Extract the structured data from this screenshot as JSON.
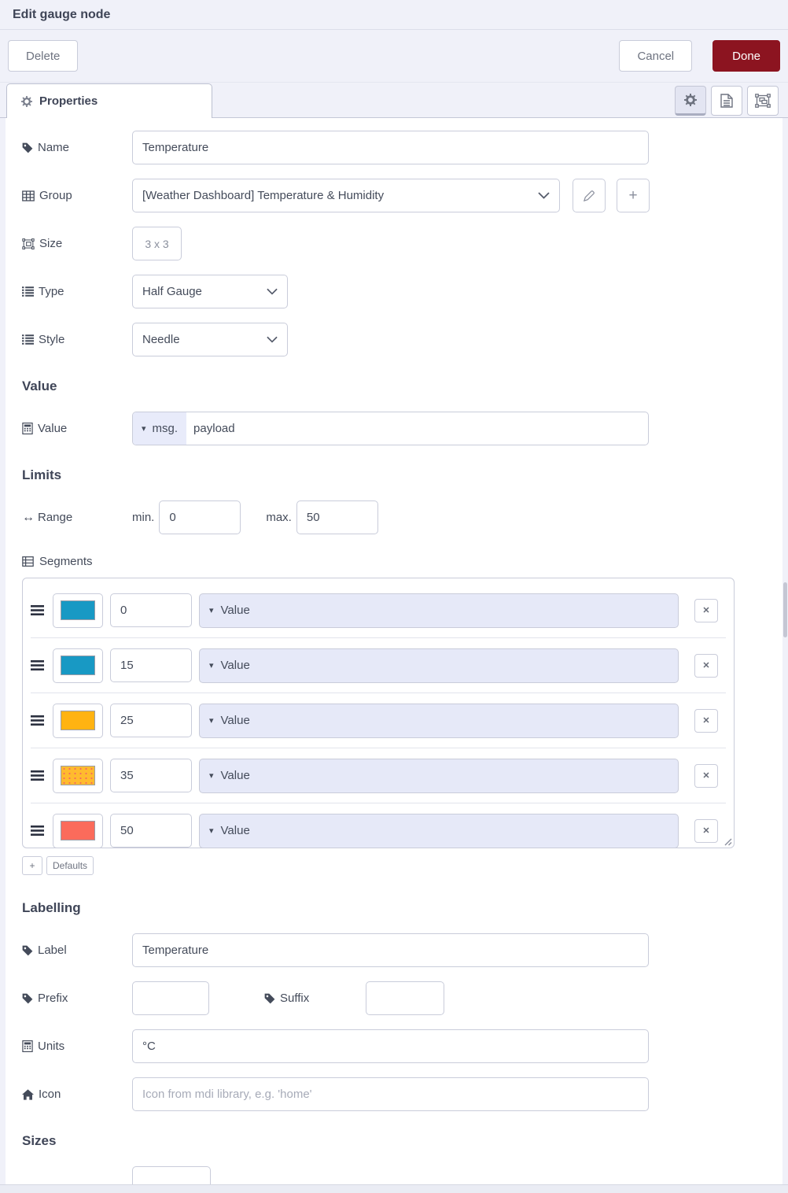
{
  "dialog": {
    "title": "Edit gauge node",
    "buttons": {
      "delete": "Delete",
      "cancel": "Cancel",
      "done": "Done"
    },
    "tab": {
      "label": "Properties"
    }
  },
  "sections": {
    "value": "Value",
    "limits": "Limits",
    "labelling": "Labelling",
    "sizes": "Sizes"
  },
  "fields": {
    "name": {
      "label": "Name",
      "value": "Temperature"
    },
    "group": {
      "label": "Group",
      "value": "[Weather Dashboard] Temperature & Humidity"
    },
    "size": {
      "label": "Size",
      "value": "3 x 3"
    },
    "type": {
      "label": "Type",
      "value": "Half Gauge"
    },
    "style": {
      "label": "Style",
      "value": "Needle"
    },
    "value": {
      "label": "Value",
      "prefix": "msg.",
      "value": "payload",
      "caret": "▾"
    },
    "range": {
      "label": "Range",
      "min_label": "min.",
      "min": "0",
      "max_label": "max.",
      "max": "50",
      "icon_glyph": "↔"
    },
    "label": {
      "label": "Label",
      "value": "Temperature"
    },
    "prefix": {
      "label": "Prefix",
      "value": ""
    },
    "suffix": {
      "label": "Suffix",
      "value": ""
    },
    "units": {
      "label": "Units",
      "value": "°C"
    },
    "icon": {
      "label": "Icon",
      "value": "",
      "placeholder": "Icon from mdi library, e.g. 'home'"
    }
  },
  "segments": {
    "label": "Segments",
    "rows": [
      {
        "color": "#1899c4",
        "value": "0",
        "type_label": "Value",
        "caret": "▾",
        "remove_label": "✕"
      },
      {
        "color": "#1899c4",
        "value": "15",
        "type_label": "Value",
        "caret": "▾",
        "remove_label": "✕"
      },
      {
        "color": "#ffb312",
        "value": "25",
        "type_label": "Value",
        "caret": "▾",
        "remove_label": "✕"
      },
      {
        "color": "#ffbb2e",
        "value": "35",
        "type_label": "Value",
        "caret": "▾",
        "remove_label": "✕"
      },
      {
        "color": "#fb6b5b",
        "value": "50",
        "type_label": "Value",
        "caret": "▾",
        "remove_label": "✕"
      }
    ],
    "add_label": "+",
    "defaults_label": "Defaults"
  },
  "colors": {
    "done_button": "#8C1420",
    "chrome_bg": "#f0f1f9",
    "typed_input_bg": "#e6e9f8",
    "segment_teal": "#1899c4",
    "segment_amber": "#ffb312",
    "segment_amber_dotted": "#ffbb2e",
    "segment_red": "#fb6b5b"
  }
}
